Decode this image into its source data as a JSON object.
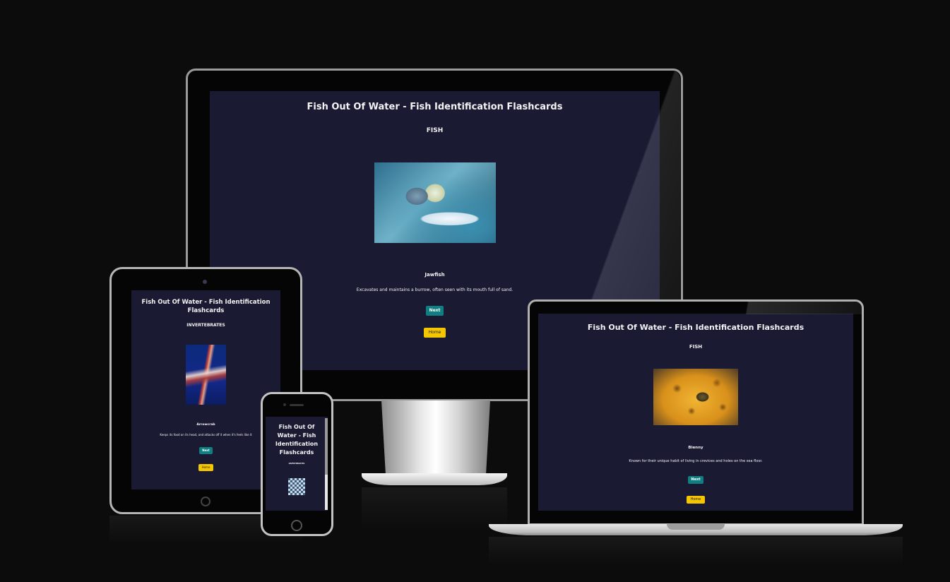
{
  "app": {
    "title": "Fish Out Of Water - Fish Identification Flashcards",
    "title_wrapped_tablet": [
      "Fish Out Of Water - Fish Identification",
      "Flashcards"
    ],
    "title_wrapped_phone": [
      "Fish Out Of",
      "Water - Fish",
      "Identification",
      "Flashcards"
    ]
  },
  "desktop": {
    "category": "FISH",
    "card_name": "Jawfish",
    "card_desc": "Excavates and maintains a burrow, often seen with its mouth full of sand.",
    "next_label": "Next",
    "home_label": "Home",
    "image_subject": "jawfish photo"
  },
  "tablet": {
    "category": "INVERTEBRATES",
    "card_name": "Arrowcrab",
    "card_desc": "Keeps its food on its head, and attacks off it when it's feels like it",
    "next_label": "Next",
    "home_label": "Home",
    "image_subject": "arrow crab photo"
  },
  "phone": {
    "category": "INVERTEBRATES",
    "image_subject": "small creature photo"
  },
  "laptop": {
    "category": "FISH",
    "card_name": "Blenny",
    "card_desc": "Known for their unique habit of living in crevices and holes on the sea floor.",
    "next_label": "Next",
    "home_label": "Home",
    "image_subject": "blenny photo"
  },
  "colors": {
    "background": "#0d0c0d",
    "screen": "#1a1a33",
    "next_button": "#0f7f82",
    "home_button": "#f3c600"
  }
}
